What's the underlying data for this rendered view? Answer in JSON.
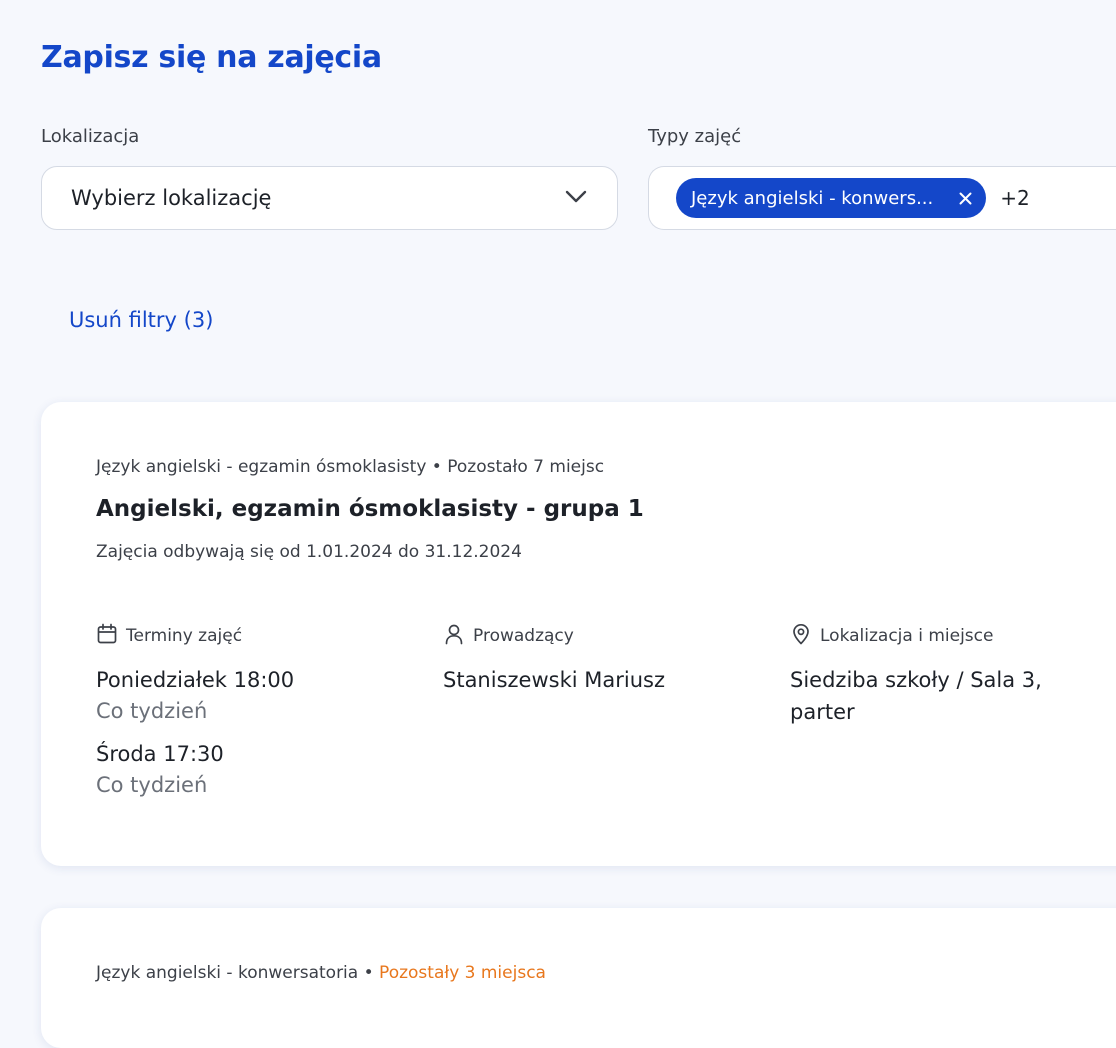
{
  "page": {
    "title": "Zapisz się na zajęcia"
  },
  "filters": {
    "location": {
      "label": "Lokalizacja",
      "placeholder": "Wybierz lokalizację",
      "icon": "chevron-down-icon"
    },
    "types": {
      "label": "Typy zajęć",
      "selected_chip": "Język angielski - konwers...",
      "chip_remove_icon": "close-icon",
      "more_count": "+2"
    },
    "clear_label": "Usuń filtry (3)"
  },
  "colors": {
    "accent": "#1447c9",
    "warning": "#e8771d",
    "background": "#f6f8fd",
    "card": "#ffffff",
    "text": "#1d2128",
    "muted": "#6b7079"
  },
  "courses": [
    {
      "category": "Język angielski - egzamin ósmoklasisty",
      "separator": "•",
      "remaining": "Pozostało 7 miejsc",
      "remaining_low": false,
      "title": "Angielski, egzamin ósmoklasisty - grupa 1",
      "dates": "Zajęcia odbywają się od 1.01.2024 do 31.12.2024",
      "schedule": {
        "label": "Terminy zajęć",
        "icon": "calendar-icon",
        "items": [
          {
            "day_time": "Poniedziałek 18:00",
            "frequency": "Co tydzień"
          },
          {
            "day_time": "Środa 17:30",
            "frequency": "Co tydzień"
          }
        ]
      },
      "teacher": {
        "label": "Prowadzący",
        "icon": "person-icon",
        "name": "Staniszewski Mariusz"
      },
      "location": {
        "label": "Lokalizacja i miejsce",
        "icon": "location-pin-icon",
        "value": "Siedziba szkoły / Sala 3, parter"
      }
    },
    {
      "category": "Język angielski - konwersatoria",
      "separator": "•",
      "remaining": "Pozostały 3 miejsca",
      "remaining_low": true
    }
  ]
}
